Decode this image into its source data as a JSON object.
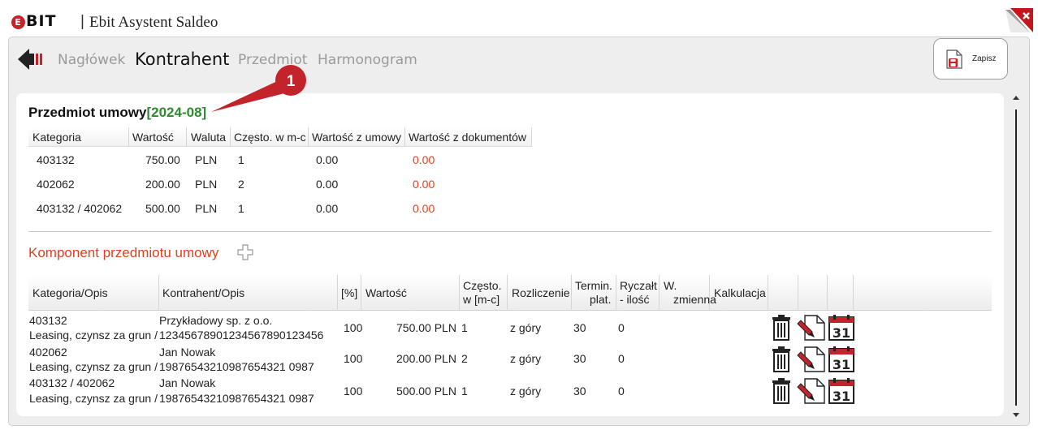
{
  "app": {
    "logo_text": "BIT",
    "logo_letter": "E",
    "title": "Ebit Asystent Saldeo"
  },
  "nav": {
    "tabs": [
      {
        "label": "Nagłówek",
        "active": false
      },
      {
        "label": "Kontrahent",
        "active": true
      },
      {
        "label": "Przedmiot",
        "active": false
      },
      {
        "label": "Harmonogram",
        "active": false
      }
    ],
    "save_label": "Zapisz"
  },
  "callout": {
    "number": "1"
  },
  "contract": {
    "title": "Przedmiot umowy",
    "period": "[2024-08]",
    "columns": [
      "Kategoria",
      "Wartość",
      "Waluta",
      "Często. w m-c",
      "Wartość z umowy",
      "Wartość z dokumentów"
    ],
    "rows": [
      {
        "kategoria": "403132",
        "wartosc": "750.00",
        "waluta": "PLN",
        "czesto": "1",
        "z_umowy": "0.00",
        "z_dokumentow": "0.00"
      },
      {
        "kategoria": "402062",
        "wartosc": "200.00",
        "waluta": "PLN",
        "czesto": "2",
        "z_umowy": "0.00",
        "z_dokumentow": "0.00"
      },
      {
        "kategoria": "403132 / 402062",
        "wartosc": "500.00",
        "waluta": "PLN",
        "czesto": "1",
        "z_umowy": "0.00",
        "z_dokumentow": "0.00"
      }
    ]
  },
  "components": {
    "title": "Komponent przedmiotu umowy",
    "columns": {
      "kategoria": "Kategoria/Opis",
      "kontrahent": "Kontrahent/Opis",
      "procent": "[%]",
      "wartosc": "Wartość",
      "czesto_1": "Często.",
      "czesto_2": "w [m-c]",
      "rozliczenie": "Rozliczenie",
      "termin_1": "Termin.",
      "termin_2": "plat.",
      "ryczalt_1": "Ryczałt",
      "ryczalt_2": "- ilość",
      "wzm_1": "W.",
      "wzm_2": "zmienna",
      "kalkulacja": "Kalkulacja"
    },
    "rows": [
      {
        "kategoria": "403132",
        "opis": "Leasing, czynsz za grun /",
        "kontrahent": "Przykładowy sp. z o.o.",
        "konto": "12345678901234567890123456",
        "procent": "100",
        "wartosc": "750.00 PLN",
        "czesto": "1",
        "rozliczenie": "z góry",
        "termin": "30",
        "ryczalt": "0"
      },
      {
        "kategoria": "402062",
        "opis": "Leasing, czynsz za grun /",
        "kontrahent": "Jan Nowak",
        "konto": "19876543210987654321 0987",
        "procent": "100",
        "wartosc": "200.00 PLN",
        "czesto": "2",
        "rozliczenie": "z góry",
        "termin": "30",
        "ryczalt": "0"
      },
      {
        "kategoria": "403132 / 402062",
        "opis": "Leasing, czynsz za grun /",
        "kontrahent": "Jan Nowak",
        "konto": "19876543210987654321 0987",
        "procent": "100",
        "wartosc": "500.00 PLN",
        "czesto": "1",
        "rozliczenie": "z góry",
        "termin": "30",
        "ryczalt": "0"
      }
    ],
    "calendar_day": "31"
  },
  "colors": {
    "accent_red": "#e0401f",
    "period_green": "#2e8b2e",
    "brand_red": "#c3232b"
  }
}
